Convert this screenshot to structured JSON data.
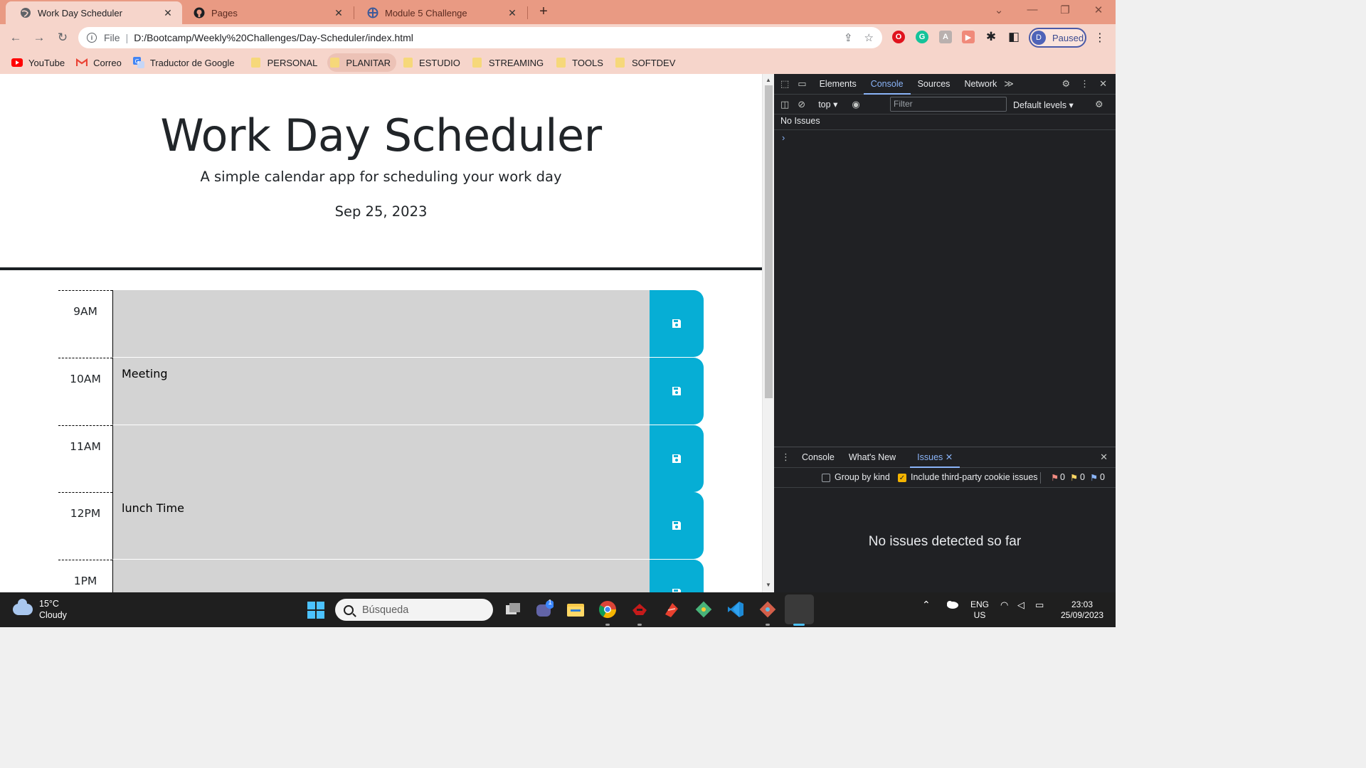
{
  "browser": {
    "tabs": [
      {
        "title": "Work Day Scheduler",
        "active": true
      },
      {
        "title": "Pages",
        "active": false
      },
      {
        "title": "Module 5 Challenge",
        "active": false
      }
    ],
    "address": {
      "scheme": "File",
      "url": "D:/Bootcamp/Weekly%20Challenges/Day-Scheduler/index.html"
    },
    "profile": {
      "initial": "D",
      "label": "Paused"
    },
    "bookmarks": [
      {
        "label": "YouTube",
        "icon": "youtube-icon"
      },
      {
        "label": "Correo",
        "icon": "gmail-icon"
      },
      {
        "label": "Traductor de Google",
        "icon": "google-translate-icon"
      },
      {
        "label": "PERSONAL",
        "icon": "folder-icon"
      },
      {
        "label": "PLANITAR",
        "icon": "folder-icon"
      },
      {
        "label": "ESTUDIO",
        "icon": "folder-icon"
      },
      {
        "label": "STREAMING",
        "icon": "folder-icon"
      },
      {
        "label": "TOOLS",
        "icon": "folder-icon"
      },
      {
        "label": "SOFTDEV",
        "icon": "folder-icon"
      }
    ]
  },
  "page": {
    "title": "Work Day Scheduler",
    "lead": "A simple calendar app for scheduling your work day",
    "current_date": "Sep 25, 2023",
    "hours": [
      {
        "label": "9AM",
        "text": ""
      },
      {
        "label": "10AM",
        "text": "Meeting"
      },
      {
        "label": "11AM",
        "text": ""
      },
      {
        "label": "12PM",
        "text": "lunch Time"
      },
      {
        "label": "1PM",
        "text": ""
      }
    ],
    "colors": {
      "past": "#d3d3d3",
      "save": "#06aed5"
    }
  },
  "devtools": {
    "tabs": [
      "Elements",
      "Console",
      "Sources",
      "Network"
    ],
    "active_tab": "Console",
    "context": "top",
    "filter_placeholder": "Filter",
    "levels": "Default levels",
    "no_issues": "No Issues",
    "drawer": {
      "tabs": [
        "Console",
        "What's New",
        "Issues"
      ],
      "active_tab": "Issues",
      "group_by_kind": "Group by kind",
      "third_party": "Include third-party cookie issues",
      "counts": {
        "errors": "0",
        "warnings": "0",
        "info": "0"
      },
      "empty_message": "No issues detected so far"
    }
  },
  "taskbar": {
    "weather": {
      "temp": "15°C",
      "condition": "Cloudy"
    },
    "search_placeholder": "Búsqueda",
    "teams_badge": "1",
    "language": {
      "lang": "ENG",
      "region": "US"
    },
    "clock": {
      "time": "23:03",
      "date": "25/09/2023"
    }
  }
}
